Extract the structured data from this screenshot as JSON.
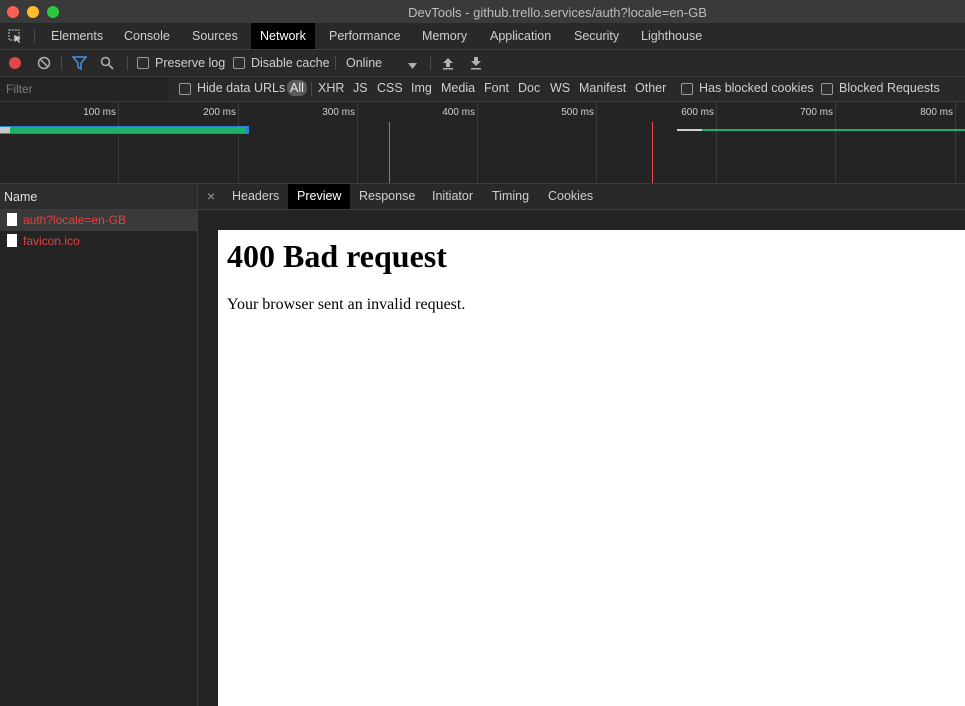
{
  "window": {
    "title": "DevTools - github.trello.services/auth?locale=en-GB"
  },
  "tabs": [
    "Elements",
    "Console",
    "Sources",
    "Network",
    "Performance",
    "Memory",
    "Application",
    "Security",
    "Lighthouse"
  ],
  "active_tab": "Network",
  "toolbar": {
    "preserve_log": "Preserve log",
    "disable_cache": "Disable cache",
    "throttling": "Online"
  },
  "filterbar": {
    "placeholder": "Filter",
    "hide_data_urls": "Hide data URLs",
    "types": [
      "All",
      "XHR",
      "JS",
      "CSS",
      "Img",
      "Media",
      "Font",
      "Doc",
      "WS",
      "Manifest",
      "Other"
    ],
    "has_blocked_cookies": "Has blocked cookies",
    "blocked_requests": "Blocked Requests"
  },
  "overview": {
    "ticks": [
      "100 ms",
      "200 ms",
      "300 ms",
      "400 ms",
      "500 ms",
      "600 ms",
      "700 ms",
      "800 ms"
    ]
  },
  "requests": {
    "header": "Name",
    "items": [
      {
        "name": "auth?locale=en-GB",
        "status_color": "#e54040"
      },
      {
        "name": "favicon.ico",
        "status_color": "#e54040"
      }
    ]
  },
  "detail": {
    "close": "×",
    "tabs": [
      "Headers",
      "Preview",
      "Response",
      "Initiator",
      "Timing",
      "Cookies"
    ],
    "active_tab": "Preview",
    "preview": {
      "heading": "400 Bad request",
      "body": "Your browser sent an invalid request."
    }
  },
  "colors": {
    "record_red": "#e04848",
    "accent_blue": "#4a90e2",
    "waterfall_green": "#1fb06a",
    "dom_content_loaded": "#3d8ef0",
    "load_event": "#e05050"
  }
}
